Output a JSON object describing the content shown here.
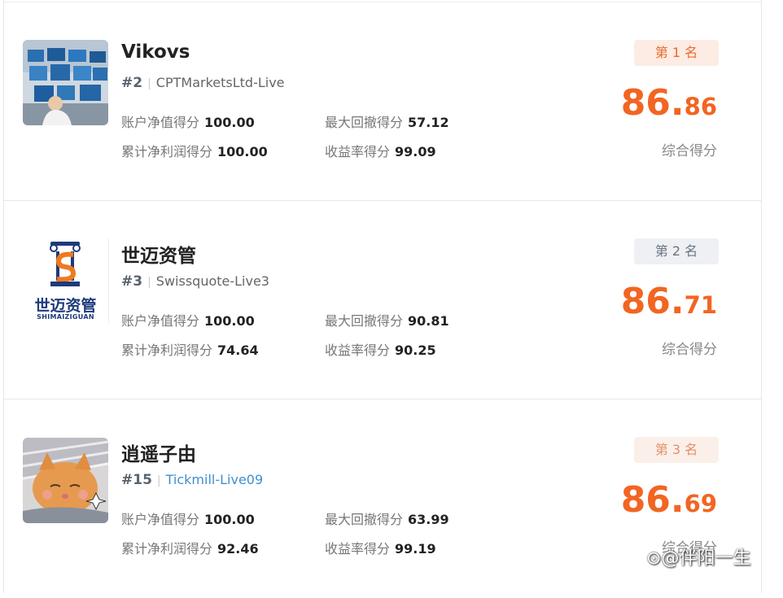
{
  "traders": [
    {
      "name": "Vikovs",
      "rank_no": "#2",
      "account": "CPTMarketsLtd-Live",
      "metrics": {
        "equity_label": "账户净值得分",
        "equity": "100.00",
        "drawdown_label": "最大回撤得分",
        "drawdown": "57.12",
        "profit_label": "累计净利润得分",
        "profit": "100.00",
        "yield_label": "收益率得分",
        "yield": "99.09"
      },
      "badge": "第 1 名",
      "score_int": "86.",
      "score_dec": "86",
      "score_label": "综合得分"
    },
    {
      "name": "世迈资管",
      "rank_no": "#3",
      "account": "Swissquote-Live3",
      "logo_text": "世迈资管",
      "logo_sub": "SHIMAIZIGUAN",
      "metrics": {
        "equity_label": "账户净值得分",
        "equity": "100.00",
        "drawdown_label": "最大回撤得分",
        "drawdown": "90.81",
        "profit_label": "累计净利润得分",
        "profit": "74.64",
        "yield_label": "收益率得分",
        "yield": "90.25"
      },
      "badge": "第 2 名",
      "score_int": "86.",
      "score_dec": "71",
      "score_label": "综合得分"
    },
    {
      "name": "逍遥子由",
      "rank_no": "#15",
      "account": "Tickmill-Live09",
      "metrics": {
        "equity_label": "账户净值得分",
        "equity": "100.00",
        "drawdown_label": "最大回撤得分",
        "drawdown": "63.99",
        "profit_label": "累计净利润得分",
        "profit": "92.46",
        "yield_label": "收益率得分",
        "yield": "99.19"
      },
      "badge": "第 3 名",
      "score_int": "86.",
      "score_dec": "69",
      "score_label": "综合得分"
    }
  ],
  "watermark": "@伴阳一生",
  "colors": {
    "score": "#f26522",
    "link": "#3f8fd0",
    "badge_first": "#fdece3"
  }
}
